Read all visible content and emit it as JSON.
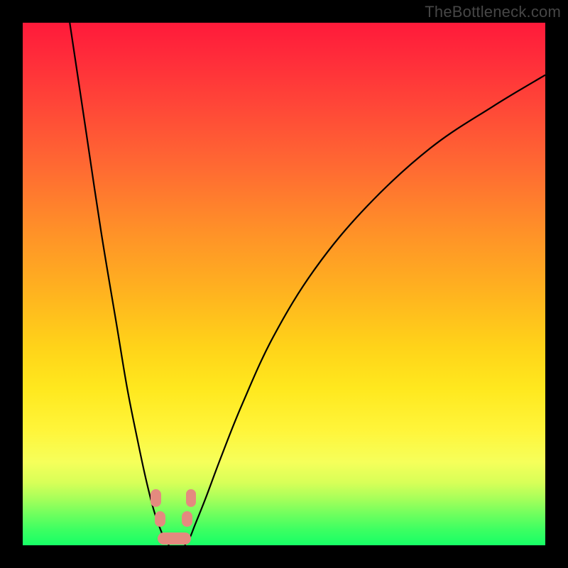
{
  "watermark": "TheBottleneck.com",
  "chart_data": {
    "type": "line",
    "title": "",
    "xlabel": "",
    "ylabel": "",
    "xlim": [
      0,
      100
    ],
    "ylim": [
      0,
      100
    ],
    "grid": false,
    "series": [
      {
        "name": "left-curve",
        "x": [
          9,
          12,
          15,
          18,
          20,
          22,
          23.5,
          25,
          26,
          27,
          28
        ],
        "y": [
          100,
          80,
          60,
          42,
          30,
          20,
          13,
          7,
          4,
          1.5,
          0
        ]
      },
      {
        "name": "right-curve",
        "x": [
          31,
          32,
          33,
          35,
          38,
          42,
          48,
          56,
          66,
          78,
          90,
          100
        ],
        "y": [
          0,
          1.5,
          4,
          9,
          17,
          27,
          40,
          53,
          65,
          76,
          84,
          90
        ]
      }
    ],
    "markers": [
      {
        "name": "left-blob-upper",
        "cx": 25.5,
        "cy": 9,
        "w": 2.0,
        "h": 3.4
      },
      {
        "name": "left-blob-lower",
        "cx": 26.3,
        "cy": 5,
        "w": 2.0,
        "h": 3.0
      },
      {
        "name": "right-blob-upper",
        "cx": 32.2,
        "cy": 9,
        "w": 2.0,
        "h": 3.4
      },
      {
        "name": "right-blob-lower",
        "cx": 31.5,
        "cy": 5,
        "w": 2.0,
        "h": 3.0
      },
      {
        "name": "bottom-blob",
        "cx": 29.0,
        "cy": 1.3,
        "w": 6.5,
        "h": 2.4
      }
    ],
    "colors": {
      "marker": "#e48a7f",
      "line": "#000000"
    }
  }
}
